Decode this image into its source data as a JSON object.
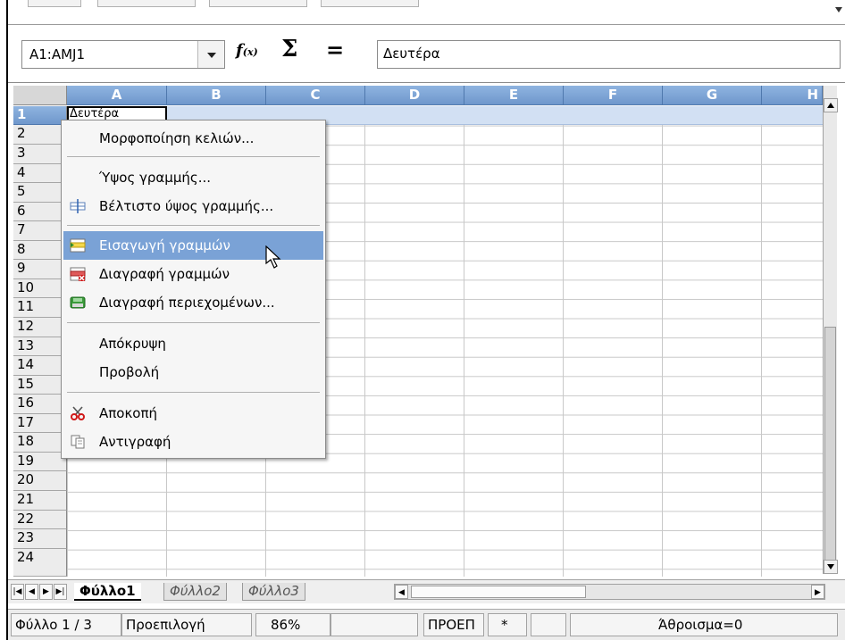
{
  "formula_bar": {
    "name_box": "A1:AMJ1",
    "fx_label": "f(x)",
    "sigma_label": "Σ",
    "equals_label": "=",
    "formula_value": "Δευτέρα"
  },
  "grid": {
    "columns": [
      "A",
      "B",
      "C",
      "D",
      "E",
      "F",
      "G",
      "H"
    ],
    "rows": [
      "1",
      "2",
      "3",
      "4",
      "5",
      "6",
      "7",
      "8",
      "9",
      "10",
      "11",
      "12",
      "13",
      "14",
      "15",
      "16",
      "17",
      "18",
      "19",
      "20",
      "21",
      "22",
      "23",
      "24"
    ],
    "selected_row": "1",
    "active_cell_value": "Δευτέρα"
  },
  "context_menu": {
    "items": [
      {
        "label": "Μορφοποίηση κελιών...",
        "icon": "none"
      },
      {
        "label": "Ύψος γραμμής...",
        "icon": "none"
      },
      {
        "label": "Βέλτιστο ύψος γραμμής...",
        "icon": "optimal-row-height-icon"
      },
      {
        "label": "Εισαγωγή γραμμών",
        "icon": "insert-rows-icon",
        "highlighted": true
      },
      {
        "label": "Διαγραφή γραμμών",
        "icon": "delete-rows-icon"
      },
      {
        "label": "Διαγραφή περιεχομένων...",
        "icon": "delete-contents-icon"
      },
      {
        "label": "Απόκρυψη",
        "icon": "none"
      },
      {
        "label": "Προβολή",
        "icon": "none"
      },
      {
        "label": "Αποκοπή",
        "icon": "scissors-icon"
      },
      {
        "label": "Αντιγραφή",
        "icon": "copy-icon"
      }
    ]
  },
  "sheet_tabs": {
    "tabs": [
      "Φύλλο1",
      "Φύλλο2",
      "Φύλλο3"
    ],
    "active": "Φύλλο1"
  },
  "status_bar": {
    "sheet_pos": "Φύλλο 1 / 3",
    "page_style": "Προεπιλογή",
    "zoom": "86%",
    "mode": "ΠΡΟΕΠ",
    "modified": "*",
    "sum": "Άθροισμα=0"
  },
  "colors": {
    "header_selected": "#7aa2d6",
    "menu_highlight": "#7aa2d6",
    "selection_row": "#d2e0f3"
  }
}
